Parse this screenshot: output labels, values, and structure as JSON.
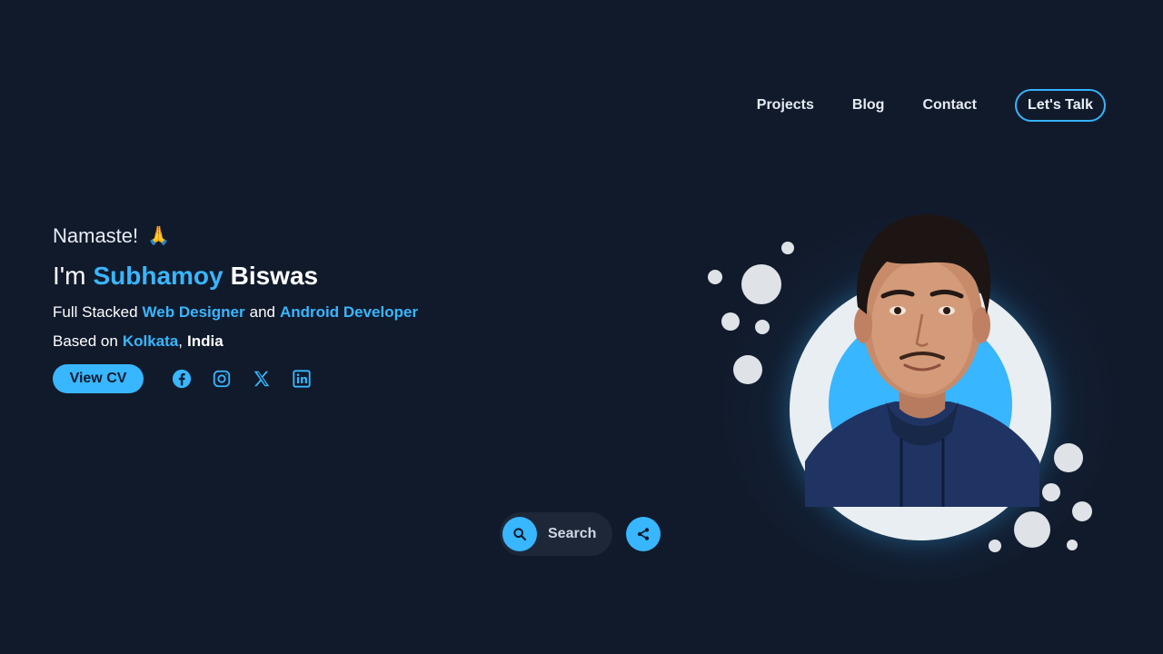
{
  "nav": {
    "links": [
      "Projects",
      "Blog",
      "Contact"
    ],
    "cta": "Let's Talk"
  },
  "hero": {
    "greeting": "Namaste!",
    "greeting_emoji": "🙏",
    "im": "I'm",
    "first_name": "Subhamoy",
    "last_name": "Biswas",
    "role_prefix": "Full Stacked",
    "role_1": "Web Designer",
    "role_and": "and",
    "role_2": "Android Developer",
    "loc_prefix": "Based on",
    "city": "Kolkata",
    "country": "India",
    "cv_button": "View CV",
    "socials": [
      "facebook-icon",
      "instagram-icon",
      "x-icon",
      "linkedin-icon"
    ]
  },
  "search": {
    "label": "Search"
  },
  "colors": {
    "background": "#111a2b",
    "accent": "#38b6ff",
    "text": "#ffffff"
  }
}
